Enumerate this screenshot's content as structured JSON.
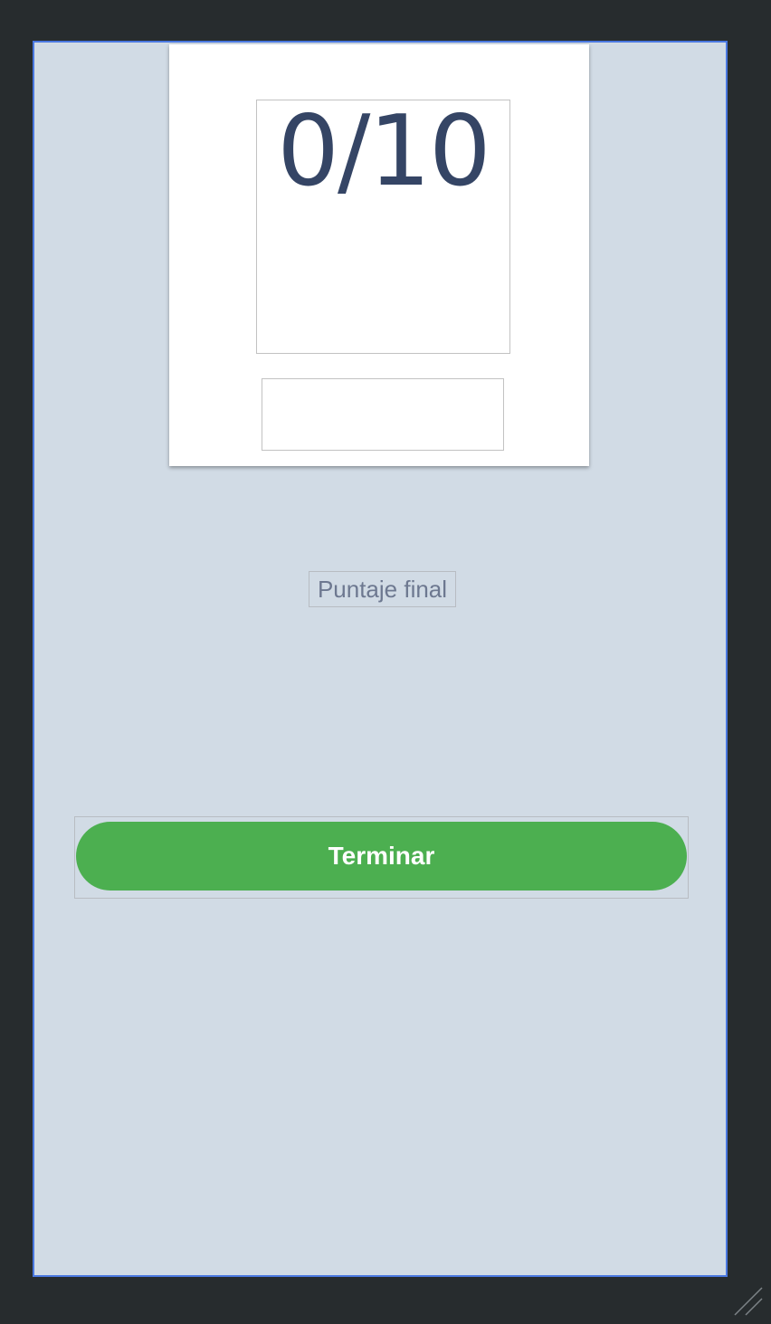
{
  "score_card": {
    "score_text": "0/10"
  },
  "final_label": "Puntaje final",
  "finish_button": {
    "label": "Terminar"
  },
  "colors": {
    "editor_background": "#272c2e",
    "screen_background": "#d1dbe5",
    "screen_border": "#4a78e0",
    "score_text": "#354565",
    "button": "#4caf50",
    "button_text": "#ffffff",
    "label_text": "#6d7890"
  },
  "icons": {
    "resize_handle": "resize-handle-icon"
  }
}
